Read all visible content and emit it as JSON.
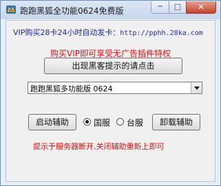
{
  "window": {
    "title": "跑跑黑狐全功能0624免费版",
    "icon": "fox-app-icon",
    "controls": {
      "minimize": "─",
      "maximize": "□",
      "close": "✕"
    }
  },
  "vip": {
    "text": "VIP购买28卡24小时自动发卡：",
    "url": "http://pphh.28ka.com"
  },
  "promo": "购买VIP即可享受无广告插件特权",
  "hacker_button": "出现黑客提示的请点击",
  "version_select": {
    "selected": "跑跑黑狐多功能版 0624"
  },
  "start_button": "启动辅助",
  "server": {
    "options": [
      {
        "label": "国服",
        "checked": true
      },
      {
        "label": "台服",
        "checked": false
      }
    ]
  },
  "unload_button": "卸载辅助",
  "hint": "提示于服务器断开,关闭辅助重新上即可",
  "colors": {
    "vip_text": "#1f2a99",
    "warning_red": "#dd1111",
    "close_button": "#c2412f"
  }
}
